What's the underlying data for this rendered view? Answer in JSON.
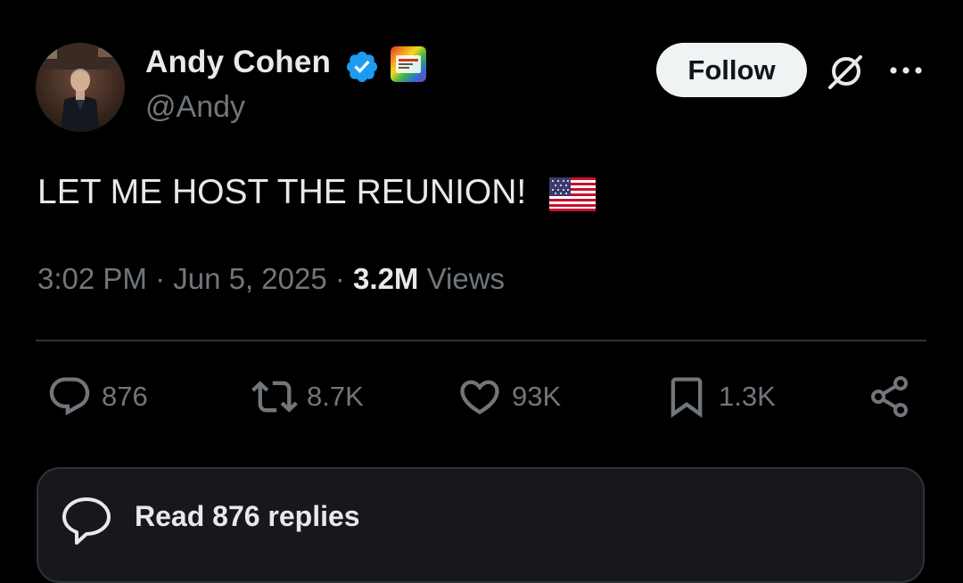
{
  "author": {
    "name": "Andy Cohen",
    "handle": "@Andy",
    "verified_icon": "verified-badge-icon",
    "affiliate_icon": "affiliate-badge-icon"
  },
  "header": {
    "follow_label": "Follow",
    "grok_icon": "grok-icon",
    "more_icon": "more-icon"
  },
  "tweet": {
    "text": "LET ME HOST THE REUNION!",
    "emoji_icon": "us-flag-icon"
  },
  "meta": {
    "time": "3:02 PM",
    "sep1": " · ",
    "date": "Jun 5, 2025",
    "sep2": " · ",
    "views_count": "3.2M",
    "views_label": " Views"
  },
  "actions": {
    "replies": "876",
    "reposts": "8.7K",
    "likes": "93K",
    "bookmarks": "1.3K"
  },
  "read_replies": {
    "label": "Read 876 replies"
  },
  "colors": {
    "background": "#000000",
    "text": "#e7e9ea",
    "secondary": "#71767b",
    "verified": "#1d9bf0",
    "follow_bg": "#eff3f4",
    "divider": "#2f3336"
  }
}
